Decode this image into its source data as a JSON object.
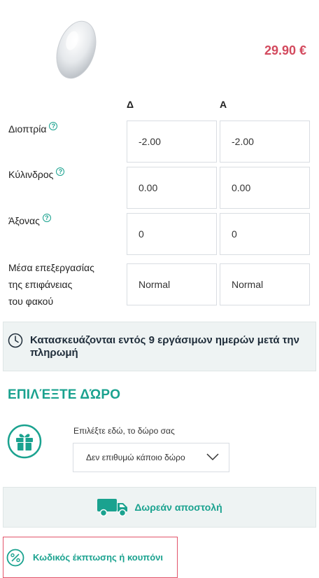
{
  "product": {
    "price": "29.90 €"
  },
  "table": {
    "col_right": "Δ",
    "col_left": "Α",
    "rows": [
      {
        "label": "Διοπτρία",
        "right": "-2.00",
        "left": "-2.00"
      },
      {
        "label": "Κύλινδρος",
        "right": "0.00",
        "left": "0.00"
      },
      {
        "label": "Άξονας",
        "right": "0",
        "left": "0"
      },
      {
        "label_1": "Μέσα επεξεργασίας",
        "label_2": "της επιφάνειας",
        "label_3": "του φακού",
        "right": "Normal",
        "left": "Normal"
      }
    ],
    "help_glyph": "?"
  },
  "production_notice": "Κατασκευάζονται εντός 9 εργάσιμων ημερών μετά την πληρωμή",
  "gift": {
    "title": "ΕΠΙΛΈΞΤΕ ΔΏΡΟ",
    "caption": "Επιλέξτε εδώ, το δώρο σας",
    "selected": "Δεν επιθυμώ κάποιο δώρο"
  },
  "shipping": {
    "label": "Δωρεάν αποστολή"
  },
  "coupon": {
    "label": "Κωδικός έκπτωσης ή κουπόνι"
  },
  "colors": {
    "accent": "#1aa28f",
    "price": "#d34a5e",
    "coupon_border": "#e2536a"
  }
}
